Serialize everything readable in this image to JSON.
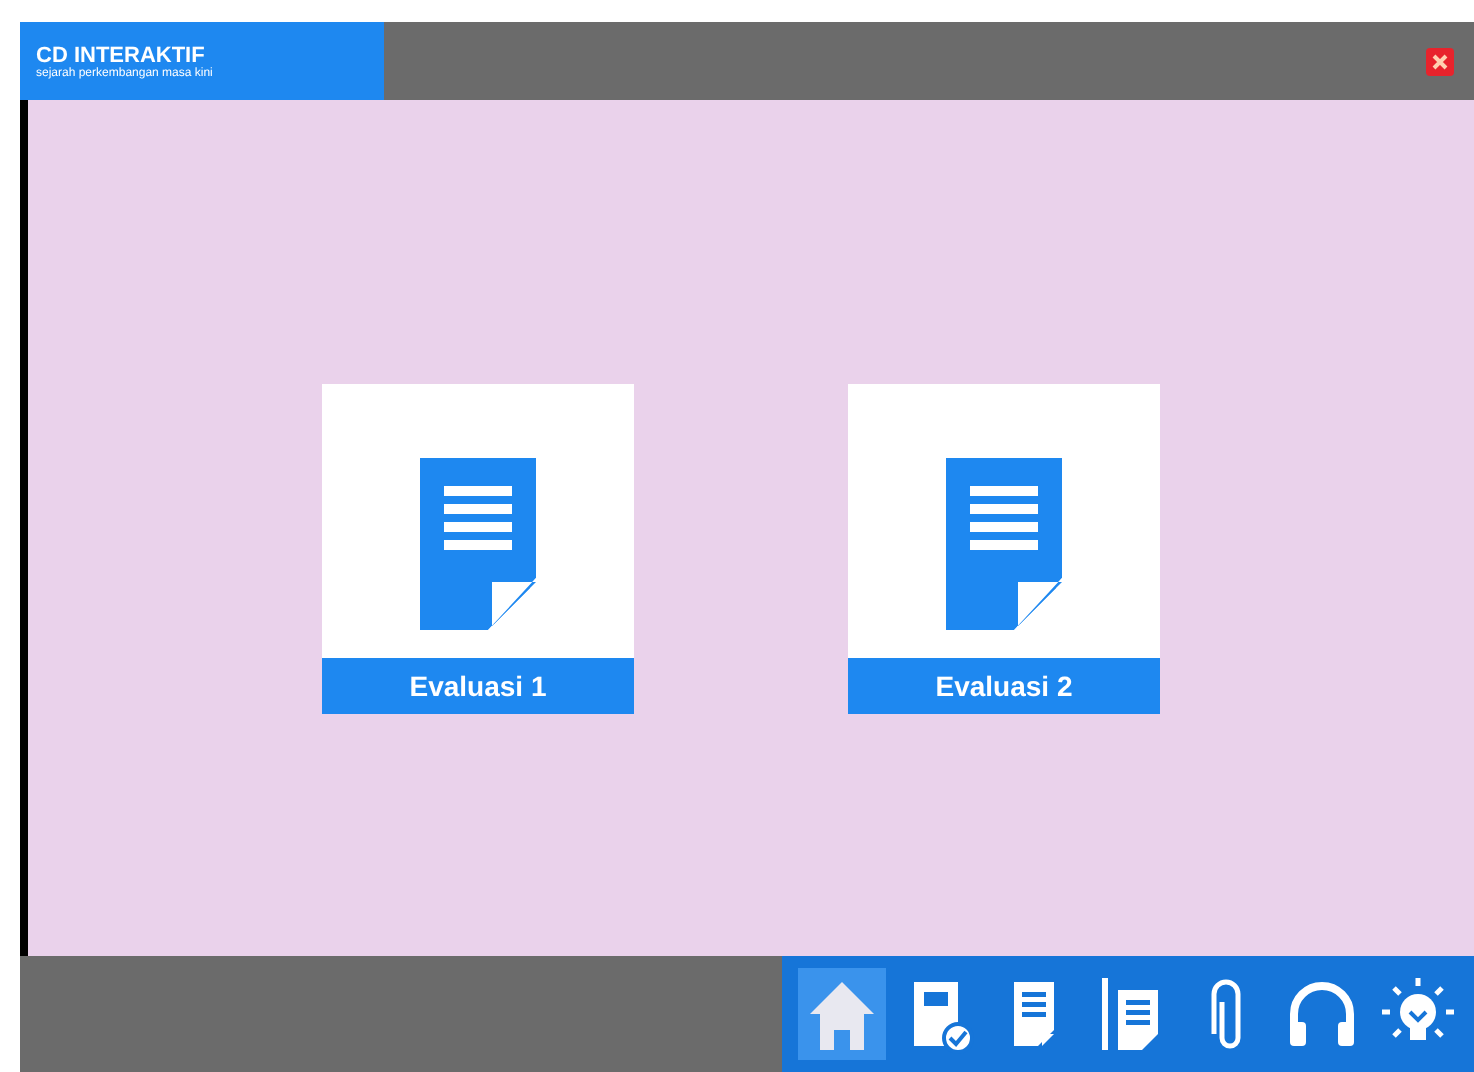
{
  "window": {
    "title": "CD INTERAKTIF",
    "subtitle": "sejarah perkembangan masa kini"
  },
  "cards": [
    {
      "label": "Evaluasi 1"
    },
    {
      "label": "Evaluasi 2"
    }
  ],
  "toolbar": [
    {
      "kind": "home",
      "selected": true
    },
    {
      "kind": "notebook",
      "selected": false
    },
    {
      "kind": "document",
      "selected": false
    },
    {
      "kind": "pencil-document",
      "selected": false
    },
    {
      "kind": "paperclip",
      "selected": false
    },
    {
      "kind": "headphones",
      "selected": false
    },
    {
      "kind": "bulb",
      "selected": false
    }
  ]
}
